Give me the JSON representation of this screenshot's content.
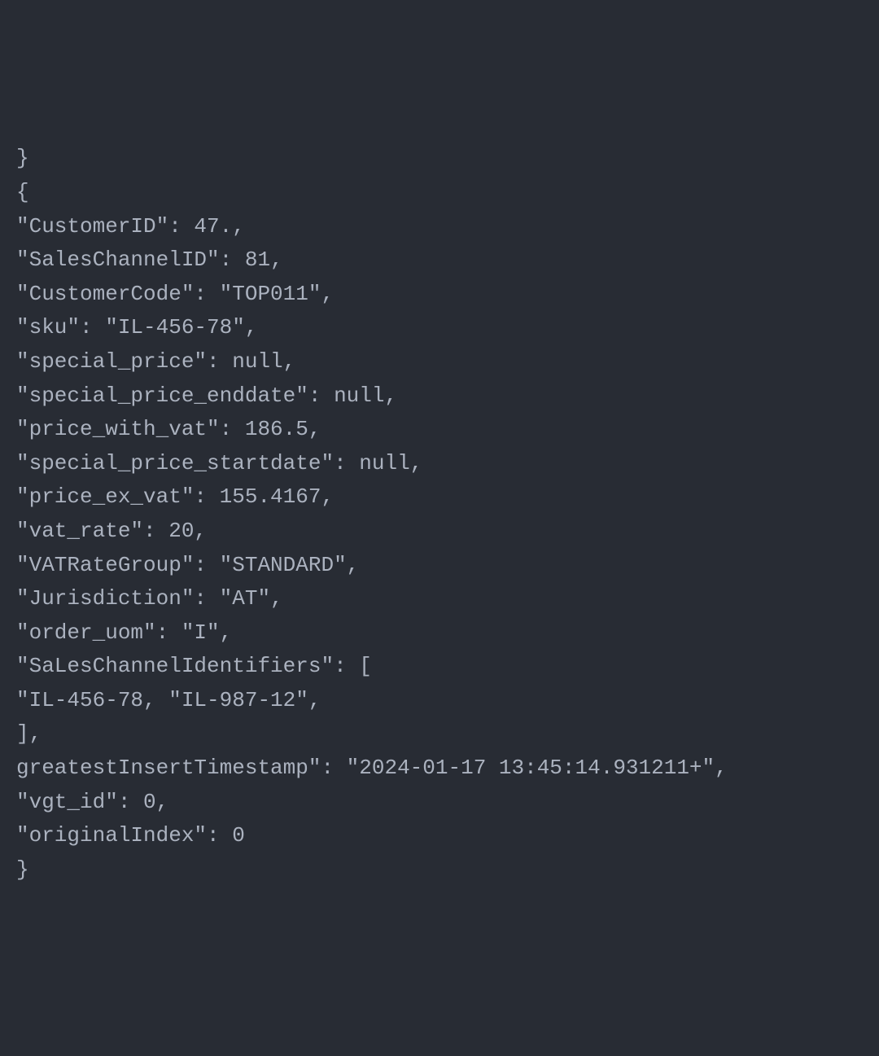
{
  "lines": [
    "}",
    "{",
    "\"CustomerID\": 47.,",
    "\"SalesChannelID\": 81,",
    "\"CustomerCode\": \"TOP011\",",
    "\"sku\": \"IL-456-78\",",
    "\"special_price\": null,",
    "\"special_price_enddate\": null,",
    "\"price_with_vat\": 186.5,",
    "\"special_price_startdate\": null,",
    "\"price_ex_vat\": 155.4167,",
    "\"vat_rate\": 20,",
    "\"VATRateGroup\": \"STANDARD\",",
    "\"Jurisdiction\": \"AT\",",
    "\"order_uom\": \"I\",",
    "\"SaLesChannelIdentifiers\": [",
    "\"IL-456-78, \"IL-987-12\",",
    "],",
    "greatestInsertTimestamp\": \"2024-01-17 13:45:14.931211+\",",
    "\"vgt_id\": 0,",
    "\"originalIndex\": 0",
    "",
    "}"
  ]
}
